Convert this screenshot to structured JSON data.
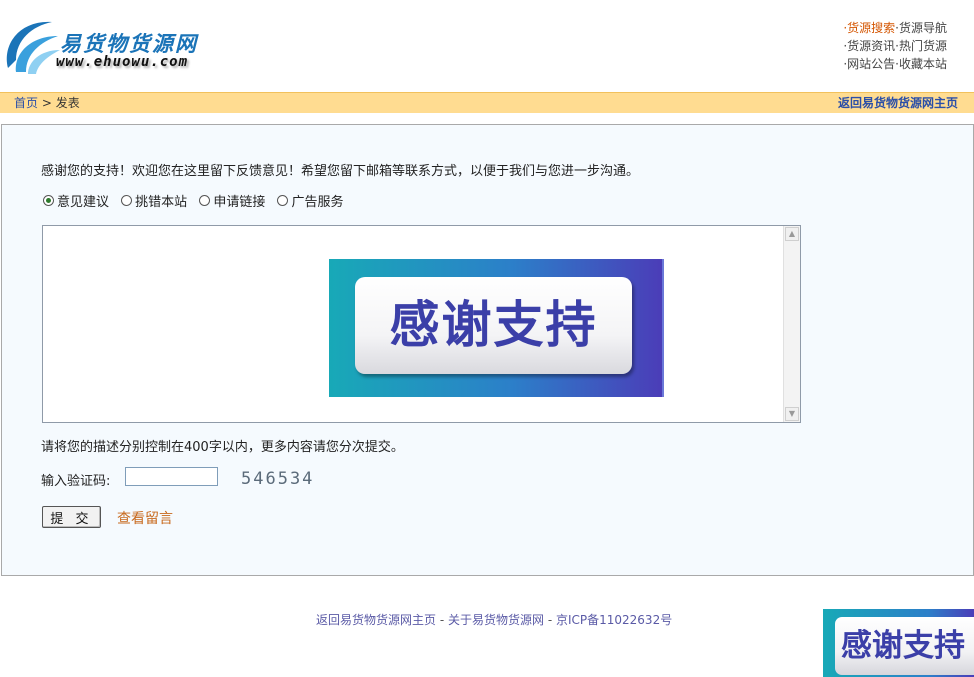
{
  "header": {
    "logo_title": "易货物货源网",
    "logo_url": "www.ehuowu.com",
    "quick_links": [
      [
        {
          "label": "·货源搜索",
          "hot": true
        },
        {
          "label": "·货源导航",
          "hot": false
        }
      ],
      [
        {
          "label": "·货源资讯",
          "hot": false
        },
        {
          "label": "·热门货源",
          "hot": false
        }
      ],
      [
        {
          "label": "·网站公告",
          "hot": false
        },
        {
          "label": "·收藏本站",
          "hot": false
        }
      ]
    ]
  },
  "breadcrumb": {
    "home": "首页",
    "separator": " > ",
    "current": "发表",
    "back_link": "返回易货物货源网主页"
  },
  "form": {
    "intro": "感谢您的支持！欢迎您在这里留下反馈意见！希望您留下邮箱等联系方式，以便于我们与您进一步沟通。",
    "radio_options": [
      {
        "label": "意见建议",
        "checked": true
      },
      {
        "label": "挑错本站",
        "checked": false
      },
      {
        "label": "申请链接",
        "checked": false
      },
      {
        "label": "广告服务",
        "checked": false
      }
    ],
    "textarea_image_text": "感谢支持",
    "limit_note": "请将您的描述分别控制在400字以内，更多内容请您分次提交。",
    "captcha_label": "输入验证码:",
    "captcha_value": "",
    "captcha_code": "546534",
    "submit_label": "提 交",
    "view_messages_link": "查看留言"
  },
  "footer": {
    "home_link": "返回易货物货源网主页",
    "sep1": " - ",
    "about_link": "关于易货物货源网",
    "sep2": " - ",
    "icp": "京ICP备11022632号",
    "corner_image_text": "感谢支持"
  },
  "colors": {
    "crumb_bar": "#ffdc91",
    "link_blue": "#2b4fa8",
    "hot_orange": "#d45500",
    "panel_bg": "#f5fafe",
    "banner_text": "#3b3fa8"
  }
}
